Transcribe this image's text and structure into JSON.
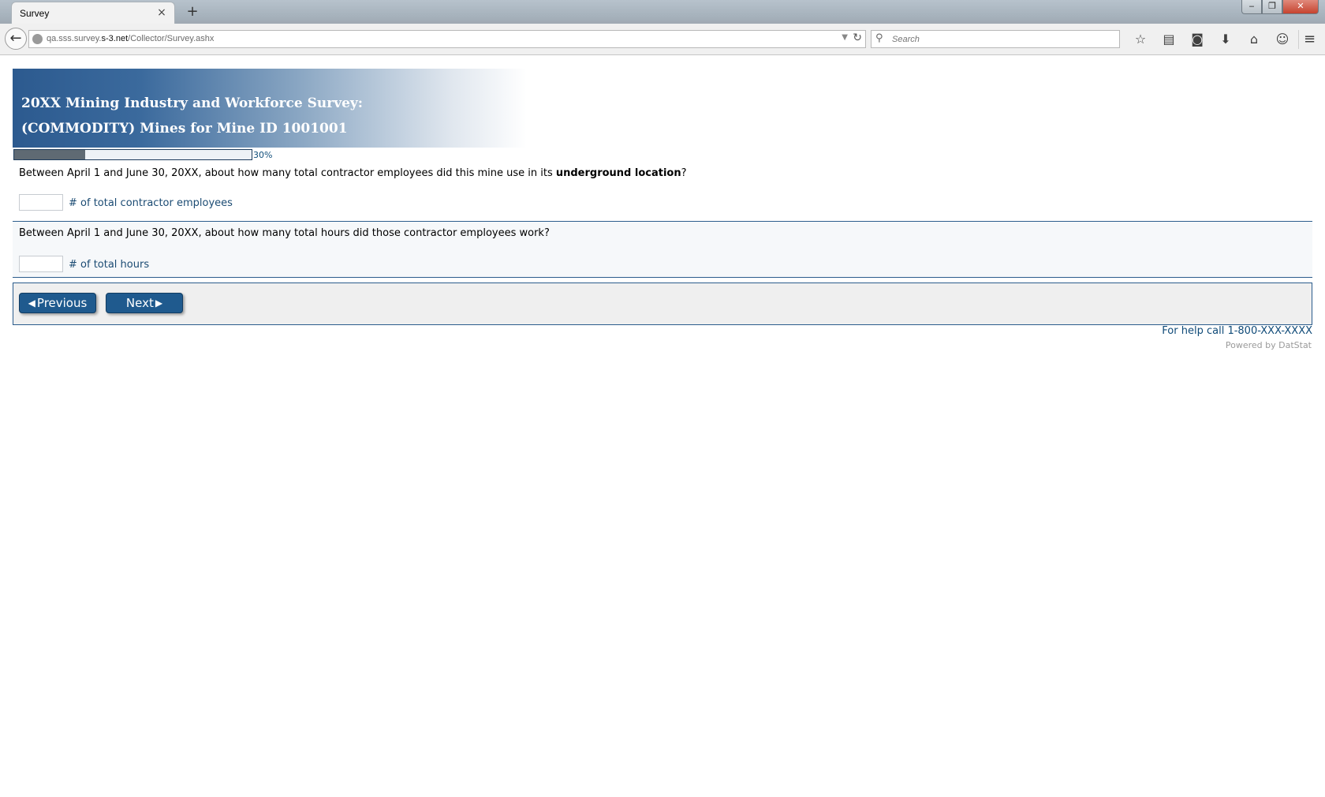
{
  "browser": {
    "tab_title": "Survey",
    "tab_close": "×",
    "new_tab": "+",
    "window_controls": {
      "minimize": "‒",
      "restore": "❐",
      "close": "✕"
    },
    "url_prefix": "qa.sss.survey.",
    "url_domain": "s-3.net",
    "url_path": "/Collector/Survey.ashx",
    "search_placeholder": "Search",
    "icons": [
      "bookmark-star-icon",
      "reading-list-icon",
      "pocket-icon",
      "download-icon",
      "home-icon",
      "chat-icon",
      "menu-icon"
    ]
  },
  "survey": {
    "title_line1": "20XX Mining Industry and Workforce Survey:",
    "title_line2": "(COMMODITY) Mines for Mine ID 1001001",
    "progress_percent": 30,
    "progress_label": "30%",
    "questions": [
      {
        "text_before": "Between April 1 and June 30, 20XX, about how many total contractor employees did this mine use in its ",
        "text_bold": "underground location",
        "text_after": "?",
        "value": "",
        "unit": "# of total contractor employees"
      },
      {
        "text": "Between April 1 and June 30, 20XX, about how many total hours did those contractor employees work?",
        "value": "",
        "unit": "# of total hours"
      }
    ],
    "buttons": {
      "previous": "Previous",
      "next": "Next"
    },
    "help_text": "For help call 1-800-XXX-XXXX",
    "powered_by": "Powered by DatStat"
  },
  "colors": {
    "accent": "#1f5a8e",
    "banner_start": "#2c5a8f",
    "link_text": "#0f4a78"
  }
}
